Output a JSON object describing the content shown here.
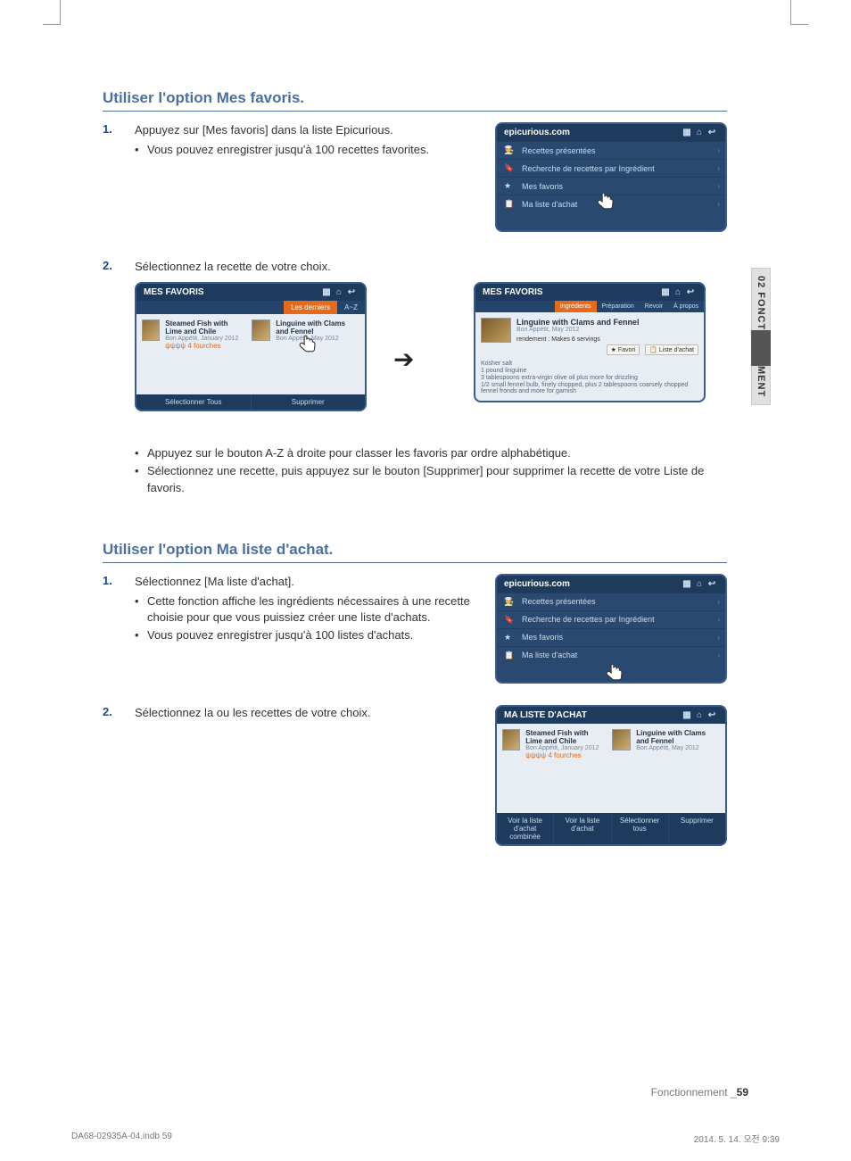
{
  "sideTab": "02  FONCTIONNEMENT",
  "section1": {
    "heading": "Utiliser l'option Mes favoris.",
    "step1": {
      "num": "1.",
      "text": "Appuyez sur [Mes favoris] dans la liste Epicurious.",
      "bullets": [
        "Vous pouvez enregistrer jusqu'à 100 recettes favorites."
      ]
    },
    "step2": {
      "num": "2.",
      "text": "Sélectionnez la recette de votre choix."
    },
    "afterScreens": [
      "Appuyez sur le bouton A-Z à droite pour classer les favoris par ordre alphabétique.",
      "Sélectionnez une recette, puis appuyez sur le bouton [Supprimer] pour supprimer la recette de votre Liste de favoris."
    ]
  },
  "section2": {
    "heading": "Utiliser l'option Ma liste d'achat.",
    "step1": {
      "num": "1.",
      "text": "Sélectionnez [Ma liste d'achat].",
      "bullets": [
        "Cette fonction affiche les ingrédients nécessaires à une recette choisie pour que vous puissiez créer une liste d'achats.",
        "Vous pouvez enregistrer jusqu'à 100 listes d'achats."
      ]
    },
    "step2": {
      "num": "2.",
      "text": "Sélectionnez la ou les recettes de votre choix."
    }
  },
  "mockMenu": {
    "title": "epicurious.com",
    "rows": [
      "Recettes présentées",
      "Recherche de recettes par Ingrédient",
      "Mes favoris",
      "Ma liste d'achat"
    ]
  },
  "mockFav": {
    "title": "MES FAVORIS",
    "tabs": {
      "a": "Les derniers",
      "b": "A~Z"
    },
    "recipe1": {
      "title": "Steamed Fish with Lime and Chile",
      "sub": "Bon Appétit, January 2012",
      "forks": "4 fourches"
    },
    "recipe2": {
      "title": "Linguine with Clams and Fennel",
      "sub": "Bon Appétit, May 2012"
    },
    "botA": "Sélectionner Tous",
    "botB": "Supprimer"
  },
  "mockDetail": {
    "title": "MES FAVORIS",
    "tabs": {
      "a": "Ingrédients",
      "b": "Préparation",
      "c": "Revoir",
      "d": "À propos"
    },
    "rtitle": "Linguine with Clams and Fennel",
    "rsub": "Bon Appétit, May 2012",
    "yield": "rendement : Makes 6 servings",
    "btnFav": "Favori",
    "btnList": "Liste d'achat",
    "ings": [
      "Kosher salt",
      "1 pound linguine",
      "3 tablespoons extra-virgin olive oil plus more for drizzling",
      "1/2 small fennel bulb, finely chopped, plus 2 tablespoons coarsely chopped fennel fronds and more for garnish"
    ]
  },
  "mockShop": {
    "title": "MA LISTE D'ACHAT",
    "recipe1": {
      "title": "Steamed Fish with Lime and Chile",
      "sub": "Bon Appétit, January 2012",
      "forks": "4 fourches"
    },
    "recipe2": {
      "title": "Linguine with Clams and Fennel",
      "sub": "Bon Appétit, May 2012"
    },
    "botA": "Voir la liste d'achat combinée",
    "botB": "Voir la liste d'achat",
    "botC": "Sélectionner tous",
    "botD": "Supprimer"
  },
  "footer": {
    "label": "Fonctionnement _",
    "page": "59"
  },
  "printFooter": {
    "left": "DA68-02935A-04.indb   59",
    "right": "2014. 5. 14.   오전 9:39"
  }
}
